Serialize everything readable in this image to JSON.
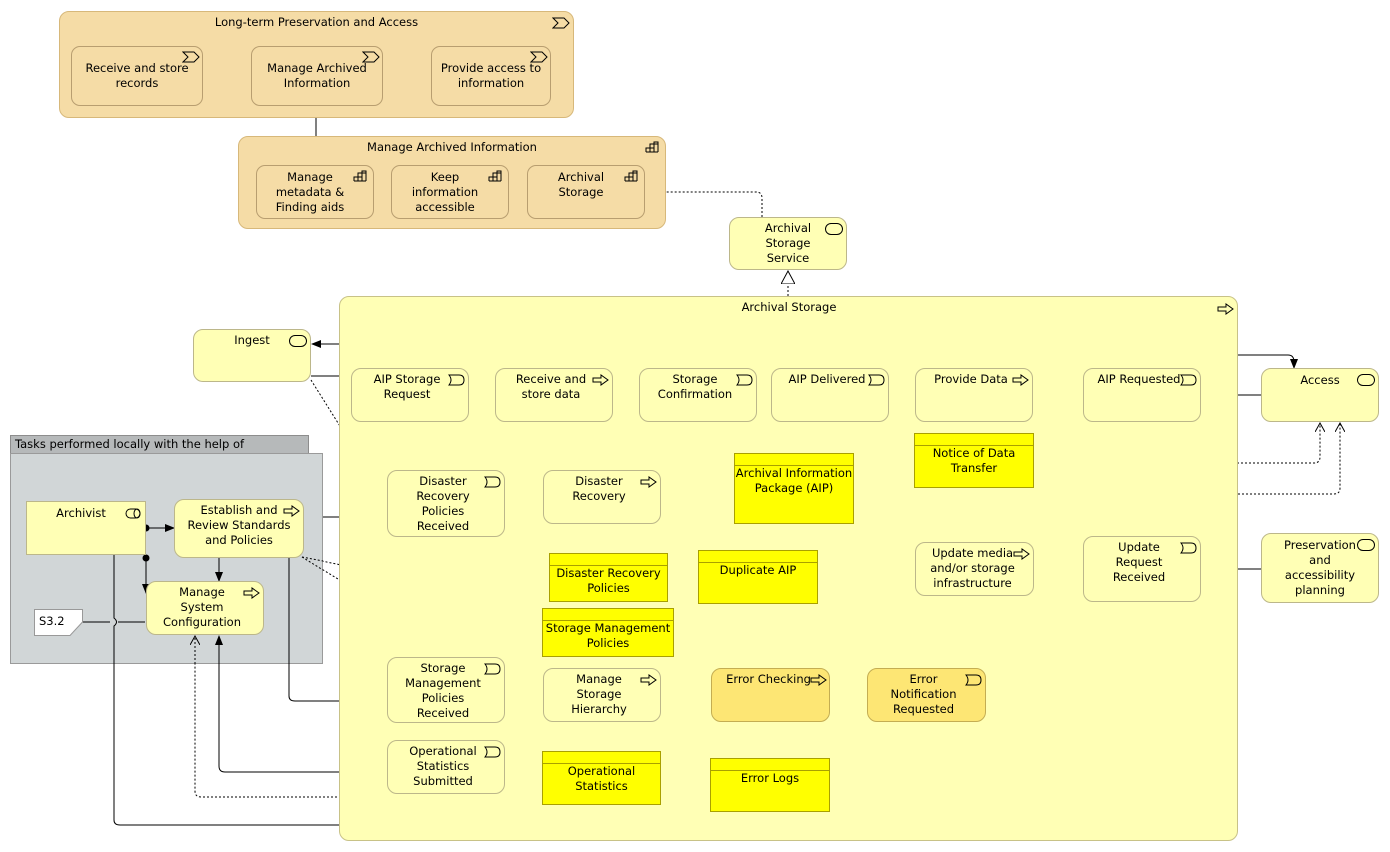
{
  "diagram": {
    "colors": {
      "business_tan": "#f5dca6",
      "app_yellow": "#ffffb5",
      "data_yellow": "#ffff00",
      "amber": "#fde674",
      "grey_group": "#d1d6d7"
    },
    "top_group": {
      "title": "Long-term Preservation and Access",
      "icon": "value-stream-icon",
      "stages": [
        {
          "label": "Receive and store\nrecords",
          "icon": "value-stream-icon"
        },
        {
          "label": "Manage Archived\nInformation",
          "icon": "value-stream-icon"
        },
        {
          "label": "Provide access to\ninformation",
          "icon": "value-stream-icon"
        }
      ]
    },
    "capability_group": {
      "title": "Manage Archived Information",
      "icon": "capability-icon",
      "items": [
        {
          "label": "Manage\nmetadata &\nFinding aids",
          "icon": "capability-icon"
        },
        {
          "label": "Keep\ninformation\naccessible",
          "icon": "capability-icon"
        },
        {
          "label": "Archival\nStorage",
          "icon": "capability-icon"
        }
      ]
    },
    "archival_storage_service": {
      "label": "Archival\nStorage\nService",
      "icon": "service-icon"
    },
    "archival_storage_group": {
      "title": "Archival Storage",
      "icon": "process-icon"
    },
    "services": {
      "ingest": {
        "label": "Ingest",
        "icon": "service-icon"
      },
      "access": {
        "label": "Access",
        "icon": "service-icon"
      },
      "preservation": {
        "label": "Preservation\nand\naccessibility\nplanning",
        "icon": "service-icon"
      }
    },
    "events": {
      "aip_storage_request": {
        "label": "AIP Storage\nRequest",
        "icon": "event-icon"
      },
      "storage_confirmation": {
        "label": "Storage\nConfirmation",
        "icon": "event-icon"
      },
      "aip_delivered": {
        "label": "AIP Delivered",
        "icon": "event-icon"
      },
      "aip_requested": {
        "label": "AIP Requested",
        "icon": "event-icon"
      },
      "dr_policies_received": {
        "label": "Disaster\nRecovery\nPolicies\nReceived",
        "icon": "event-icon"
      },
      "update_request_received": {
        "label": "Update\nRequest\nReceived",
        "icon": "event-icon"
      },
      "sm_policies_received": {
        "label": "Storage\nManagement\nPolicies\nReceived",
        "icon": "event-icon"
      },
      "error_notification_requested": {
        "label": "Error\nNotification\nRequested",
        "icon": "event-icon"
      },
      "op_stats_submitted": {
        "label": "Operational\nStatistics\nSubmitted",
        "icon": "event-icon"
      }
    },
    "processes": {
      "receive_store_data": {
        "label": "Receive and\nstore data",
        "icon": "process-icon"
      },
      "provide_data": {
        "label": "Provide Data",
        "icon": "process-icon"
      },
      "disaster_recovery": {
        "label": "Disaster\nRecovery",
        "icon": "process-icon"
      },
      "update_media": {
        "label": "Update media\nand/or storage\ninfrastructure",
        "icon": "process-icon"
      },
      "manage_storage_hierarchy": {
        "label": "Manage\nStorage\nHierarchy",
        "icon": "process-icon"
      },
      "error_checking": {
        "label": "Error Checking",
        "icon": "process-icon"
      },
      "establish_review": {
        "label": "Establish and\nReview Standards\nand Policies",
        "icon": "process-icon"
      },
      "manage_system_config": {
        "label": "Manage\nSystem\nConfiguration",
        "icon": "process-icon"
      }
    },
    "data_objects": {
      "aip": "Archival Information\nPackage (AIP)",
      "notice_data_transfer": "Notice of Data\nTransfer",
      "dr_policies": "Disaster Recovery\nPolicies",
      "duplicate_aip": "Duplicate AIP",
      "sm_policies": "Storage Management\nPolicies",
      "op_statistics": "Operational Statistics",
      "error_logs": "Error Logs"
    },
    "local_group": {
      "title": "Tasks performed locally with the help of Administration",
      "actor": {
        "label": "Archivist",
        "icon": "role-icon"
      },
      "note": "S3.2"
    }
  }
}
